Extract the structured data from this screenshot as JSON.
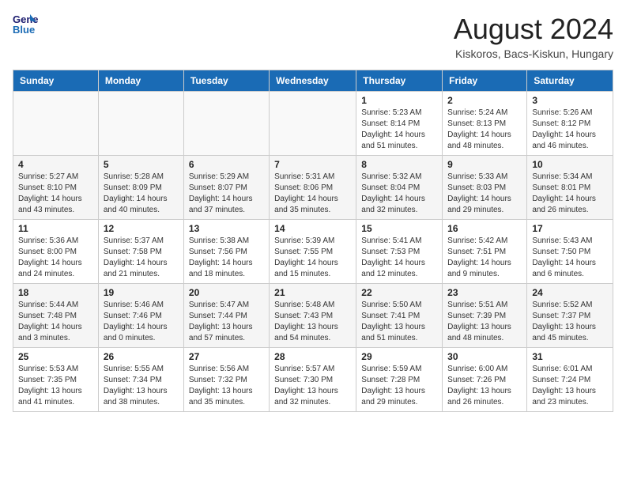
{
  "header": {
    "logo_line1": "General",
    "logo_line2": "Blue",
    "month": "August 2024",
    "location": "Kiskoros, Bacs-Kiskun, Hungary"
  },
  "weekdays": [
    "Sunday",
    "Monday",
    "Tuesday",
    "Wednesday",
    "Thursday",
    "Friday",
    "Saturday"
  ],
  "weeks": [
    [
      {
        "day": "",
        "info": ""
      },
      {
        "day": "",
        "info": ""
      },
      {
        "day": "",
        "info": ""
      },
      {
        "day": "",
        "info": ""
      },
      {
        "day": "1",
        "info": "Sunrise: 5:23 AM\nSunset: 8:14 PM\nDaylight: 14 hours\nand 51 minutes."
      },
      {
        "day": "2",
        "info": "Sunrise: 5:24 AM\nSunset: 8:13 PM\nDaylight: 14 hours\nand 48 minutes."
      },
      {
        "day": "3",
        "info": "Sunrise: 5:26 AM\nSunset: 8:12 PM\nDaylight: 14 hours\nand 46 minutes."
      }
    ],
    [
      {
        "day": "4",
        "info": "Sunrise: 5:27 AM\nSunset: 8:10 PM\nDaylight: 14 hours\nand 43 minutes."
      },
      {
        "day": "5",
        "info": "Sunrise: 5:28 AM\nSunset: 8:09 PM\nDaylight: 14 hours\nand 40 minutes."
      },
      {
        "day": "6",
        "info": "Sunrise: 5:29 AM\nSunset: 8:07 PM\nDaylight: 14 hours\nand 37 minutes."
      },
      {
        "day": "7",
        "info": "Sunrise: 5:31 AM\nSunset: 8:06 PM\nDaylight: 14 hours\nand 35 minutes."
      },
      {
        "day": "8",
        "info": "Sunrise: 5:32 AM\nSunset: 8:04 PM\nDaylight: 14 hours\nand 32 minutes."
      },
      {
        "day": "9",
        "info": "Sunrise: 5:33 AM\nSunset: 8:03 PM\nDaylight: 14 hours\nand 29 minutes."
      },
      {
        "day": "10",
        "info": "Sunrise: 5:34 AM\nSunset: 8:01 PM\nDaylight: 14 hours\nand 26 minutes."
      }
    ],
    [
      {
        "day": "11",
        "info": "Sunrise: 5:36 AM\nSunset: 8:00 PM\nDaylight: 14 hours\nand 24 minutes."
      },
      {
        "day": "12",
        "info": "Sunrise: 5:37 AM\nSunset: 7:58 PM\nDaylight: 14 hours\nand 21 minutes."
      },
      {
        "day": "13",
        "info": "Sunrise: 5:38 AM\nSunset: 7:56 PM\nDaylight: 14 hours\nand 18 minutes."
      },
      {
        "day": "14",
        "info": "Sunrise: 5:39 AM\nSunset: 7:55 PM\nDaylight: 14 hours\nand 15 minutes."
      },
      {
        "day": "15",
        "info": "Sunrise: 5:41 AM\nSunset: 7:53 PM\nDaylight: 14 hours\nand 12 minutes."
      },
      {
        "day": "16",
        "info": "Sunrise: 5:42 AM\nSunset: 7:51 PM\nDaylight: 14 hours\nand 9 minutes."
      },
      {
        "day": "17",
        "info": "Sunrise: 5:43 AM\nSunset: 7:50 PM\nDaylight: 14 hours\nand 6 minutes."
      }
    ],
    [
      {
        "day": "18",
        "info": "Sunrise: 5:44 AM\nSunset: 7:48 PM\nDaylight: 14 hours\nand 3 minutes."
      },
      {
        "day": "19",
        "info": "Sunrise: 5:46 AM\nSunset: 7:46 PM\nDaylight: 14 hours\nand 0 minutes."
      },
      {
        "day": "20",
        "info": "Sunrise: 5:47 AM\nSunset: 7:44 PM\nDaylight: 13 hours\nand 57 minutes."
      },
      {
        "day": "21",
        "info": "Sunrise: 5:48 AM\nSunset: 7:43 PM\nDaylight: 13 hours\nand 54 minutes."
      },
      {
        "day": "22",
        "info": "Sunrise: 5:50 AM\nSunset: 7:41 PM\nDaylight: 13 hours\nand 51 minutes."
      },
      {
        "day": "23",
        "info": "Sunrise: 5:51 AM\nSunset: 7:39 PM\nDaylight: 13 hours\nand 48 minutes."
      },
      {
        "day": "24",
        "info": "Sunrise: 5:52 AM\nSunset: 7:37 PM\nDaylight: 13 hours\nand 45 minutes."
      }
    ],
    [
      {
        "day": "25",
        "info": "Sunrise: 5:53 AM\nSunset: 7:35 PM\nDaylight: 13 hours\nand 41 minutes."
      },
      {
        "day": "26",
        "info": "Sunrise: 5:55 AM\nSunset: 7:34 PM\nDaylight: 13 hours\nand 38 minutes."
      },
      {
        "day": "27",
        "info": "Sunrise: 5:56 AM\nSunset: 7:32 PM\nDaylight: 13 hours\nand 35 minutes."
      },
      {
        "day": "28",
        "info": "Sunrise: 5:57 AM\nSunset: 7:30 PM\nDaylight: 13 hours\nand 32 minutes."
      },
      {
        "day": "29",
        "info": "Sunrise: 5:59 AM\nSunset: 7:28 PM\nDaylight: 13 hours\nand 29 minutes."
      },
      {
        "day": "30",
        "info": "Sunrise: 6:00 AM\nSunset: 7:26 PM\nDaylight: 13 hours\nand 26 minutes."
      },
      {
        "day": "31",
        "info": "Sunrise: 6:01 AM\nSunset: 7:24 PM\nDaylight: 13 hours\nand 23 minutes."
      }
    ]
  ]
}
